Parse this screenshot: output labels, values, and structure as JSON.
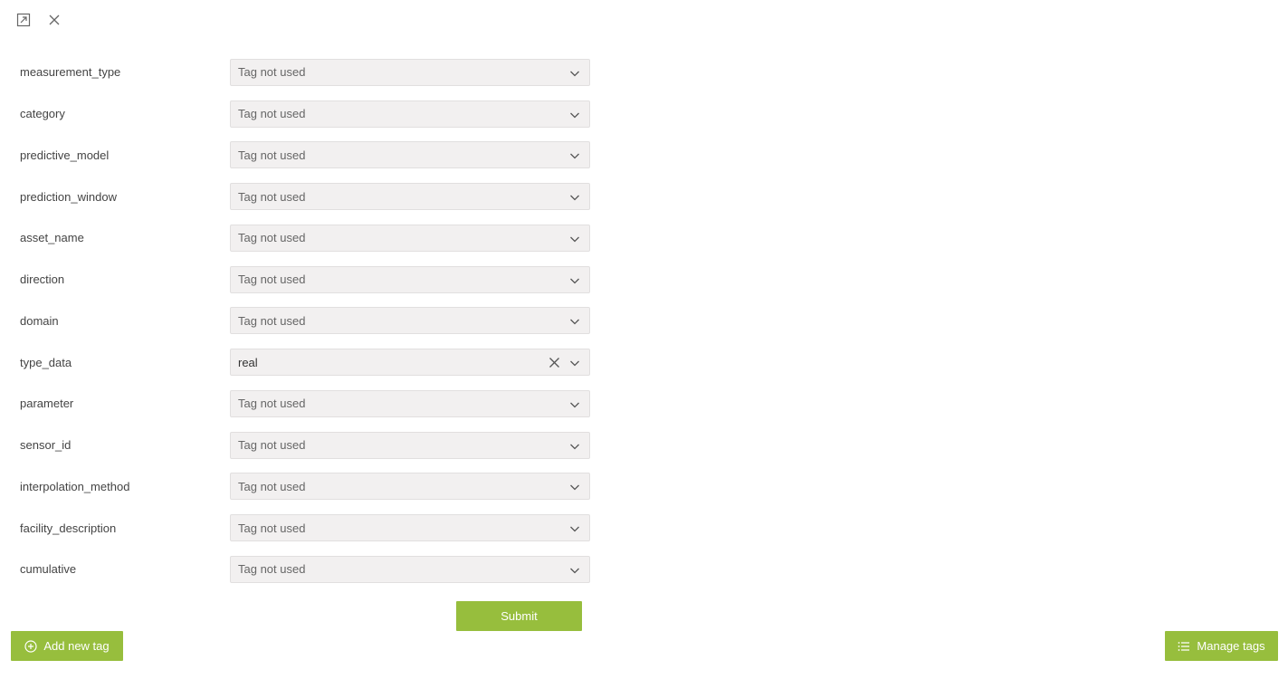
{
  "header": {
    "expand_icon": "expand-icon",
    "close_icon": "close-icon"
  },
  "rows": [
    {
      "label": "measurement_type",
      "value": "Tag not used"
    },
    {
      "label": "category",
      "value": "Tag not used"
    },
    {
      "label": "predictive_model",
      "value": "Tag not used"
    },
    {
      "label": "prediction_window",
      "value": "Tag not used"
    },
    {
      "label": "asset_name",
      "value": "Tag not used"
    },
    {
      "label": "direction",
      "value": "Tag not used"
    },
    {
      "label": "domain",
      "value": "Tag not used"
    },
    {
      "label": "type_data",
      "value": "real"
    },
    {
      "label": "parameter",
      "value": "Tag not used"
    },
    {
      "label": "sensor_id",
      "value": "Tag not used"
    },
    {
      "label": "interpolation_method",
      "value": "Tag not used"
    },
    {
      "label": "facility_description",
      "value": "Tag not used"
    },
    {
      "label": "cumulative",
      "value": "Tag not used"
    }
  ],
  "buttons": {
    "submit": "Submit",
    "add_new_tag": "Add new tag",
    "manage_tags": "Manage tags"
  },
  "colors": {
    "accent": "#97be3d",
    "select_bg": "#f2f0f0"
  }
}
